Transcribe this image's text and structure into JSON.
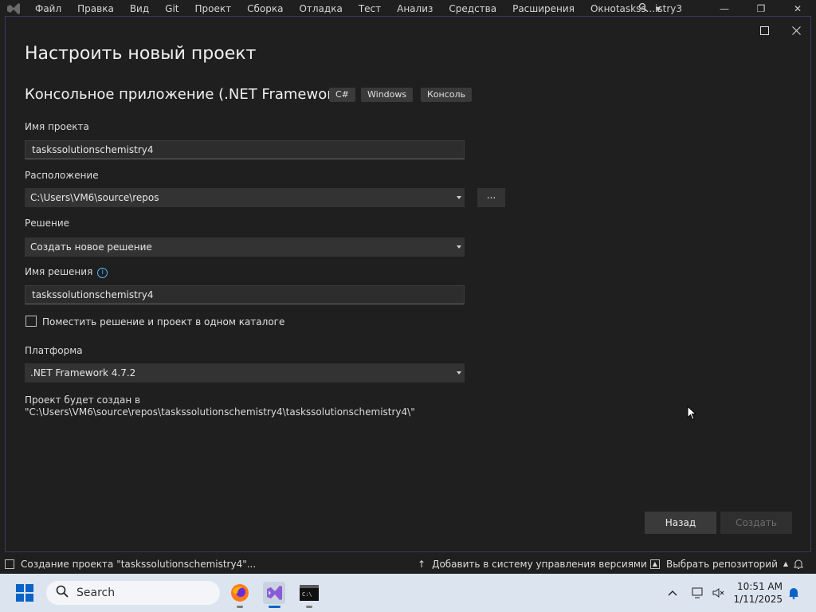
{
  "menubar": {
    "items": [
      "Файл",
      "Правка",
      "Вид",
      "Git",
      "Проект",
      "Сборка",
      "Отладка",
      "Тест",
      "Анализ",
      "Средства",
      "Расширения",
      "Окно"
    ],
    "title": "taskss...istry3"
  },
  "dialog": {
    "title": "Настроить новый проект",
    "template_name": "Консольное приложение (.NET Framework)",
    "tags": [
      "C#",
      "Windows",
      "Консоль"
    ],
    "project_name_label": "Имя проекта",
    "project_name_value": "taskssolutionschemistry4",
    "location_label": "Расположение",
    "location_value": "C:\\Users\\VM6\\source\\repos",
    "browse_label": "...",
    "solution_label": "Решение",
    "solution_value": "Создать новое решение",
    "solution_name_label": "Имя решения",
    "solution_name_value": "taskssolutionschemistry4",
    "same_dir_checkbox_label": "Поместить решение и проект в одном каталоге",
    "same_dir_checked": false,
    "framework_label": "Платформа",
    "framework_value": ".NET Framework 4.7.2",
    "path_info": "Проект будет создан в \"C:\\Users\\VM6\\source\\repos\\taskssolutionschemistry4\\taskssolutionschemistry4\\\"",
    "back_button": "Назад",
    "create_button": "Создать"
  },
  "statusbar": {
    "message": "Создание проекта \"taskssolutionschemistry4\"...",
    "source_control": "Добавить в систему управления версиями",
    "repository": "Выбрать репозиторий"
  },
  "taskbar": {
    "search_placeholder": "Search",
    "time": "10:51 AM",
    "date": "1/11/2025"
  },
  "colors": {
    "background": "#1f1f1f",
    "dialog_border": "#3a3a5a",
    "field_bg": "#2d2d2d",
    "button_bg": "#3a3a3a",
    "accent_blue": "#4fb3ff",
    "taskbar_bg": "#dce4ef"
  }
}
